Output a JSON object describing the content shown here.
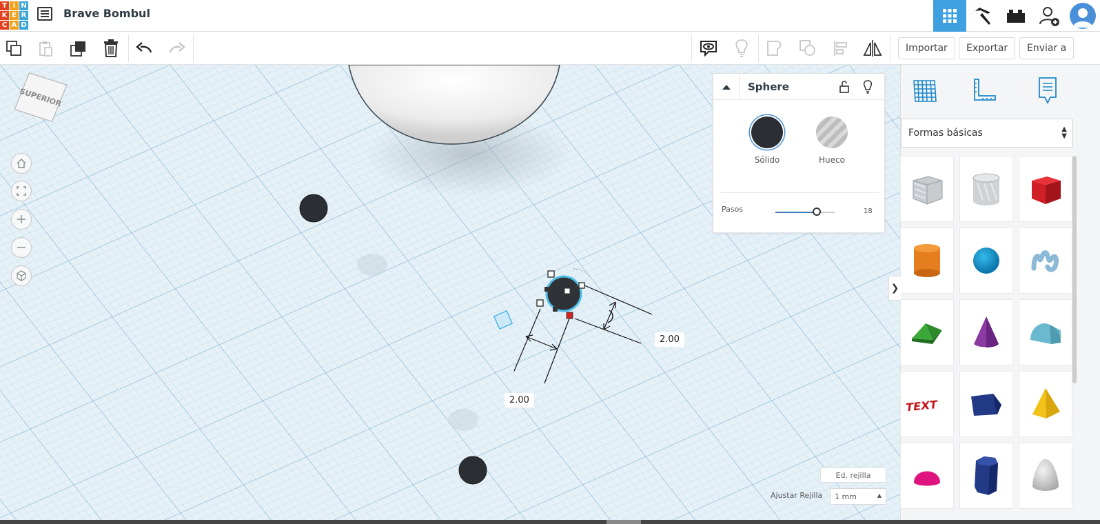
{
  "app": {
    "logo_letters": [
      "T",
      "I",
      "N",
      "K",
      "E",
      "R",
      "C",
      "A",
      "D"
    ],
    "logo_colors": [
      "#e2401e",
      "#f2a11c",
      "#3aa5dd",
      "#e2401e",
      "#f2a11c",
      "#3aa5dd",
      "#e2401e",
      "#f2a11c",
      "#3aa5dd"
    ],
    "design_title": "Brave Bombul"
  },
  "header_icons": [
    "grid-view-icon",
    "pickaxe-icon",
    "bricks-icon",
    "add-user-icon",
    "user-avatar"
  ],
  "toolbar": {
    "import_label": "Importar",
    "export_label": "Exportar",
    "send_label": "Enviar a"
  },
  "viewcube": {
    "face_label": "SUPERIOR"
  },
  "inspector": {
    "title": "Sphere",
    "solid_label": "Sólido",
    "hole_label": "Hueco",
    "steps_label": "Pasos",
    "steps_value": "18",
    "steps_fraction": 0.7
  },
  "dimensions": {
    "width": "2.00",
    "depth": "2.00"
  },
  "right_panel": {
    "category": "Formas básicas",
    "shapes": [
      "box",
      "cylinder-hole",
      "box-red",
      "cylinder",
      "sphere",
      "scribble",
      "roof",
      "cone",
      "round-roof",
      "text",
      "polygon",
      "pyramid",
      "half-sphere",
      "hexagonal-prism",
      "paraboloid"
    ]
  },
  "grid": {
    "edit_grid_label": "Ed. rejilla",
    "snap_label": "Ajustar Rejilla",
    "snap_value": "1 mm"
  },
  "colors": {
    "accent": "#3fa0e0",
    "canvas_bg": "#dcecf5",
    "solid_color": "#2b2f33"
  }
}
